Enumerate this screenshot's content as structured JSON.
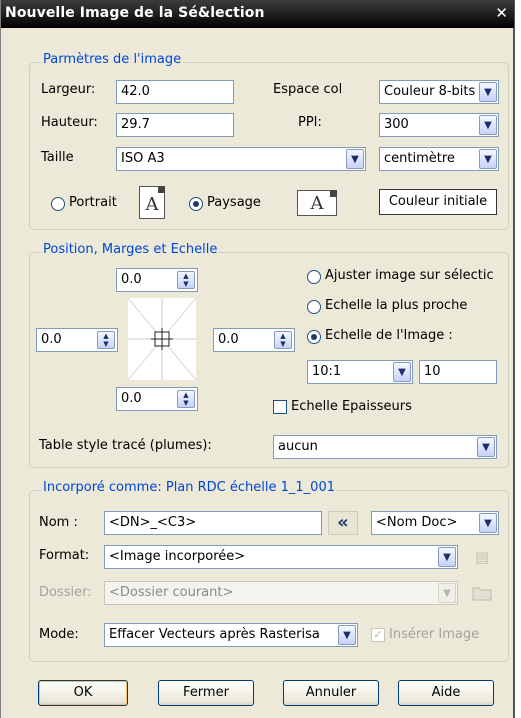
{
  "window": {
    "title": "Nouvelle Image de la Sé&lection",
    "close_glyph": "✕"
  },
  "image_params": {
    "group_title": "Parmètres de l'image",
    "width_label": "Largeur:",
    "width_value": "42.0",
    "height_label": "Hauteur:",
    "height_value": "29.7",
    "size_label": "Taille",
    "size_value": "ISO A3",
    "colorspace_label": "Espace col",
    "colorspace_value": "Couleur 8-bits",
    "ppi_label": "PPI:",
    "ppi_value": "300",
    "unit_value": "centimètre",
    "portrait_label": "Portrait",
    "portrait_selected": false,
    "landscape_label": "Paysage",
    "landscape_selected": true,
    "page_icon_glyph": "A",
    "initial_color_button": "Couleur initiale"
  },
  "position": {
    "group_title": "Position, Marges et Echelle",
    "margin_top": "0.0",
    "margin_left": "0.0",
    "margin_right": "0.0",
    "margin_bottom": "0.0",
    "fit_label": "Ajuster image sur sélectic",
    "fit_selected": false,
    "nearest_label": "Echelle la plus proche",
    "nearest_selected": false,
    "image_scale_label": "Echelle de l'Image :",
    "image_scale_selected": true,
    "scale_select": "10:1",
    "scale_value": "10",
    "thickness_scale_label": "Echelle Epaisseurs",
    "thickness_scale_checked": false,
    "pen_table_label": "Table style tracé (plumes):",
    "pen_table_value": "aucun"
  },
  "embed": {
    "group_title": "Incorporé comme: Plan RDC échelle 1_1_001",
    "name_label": "Nom :",
    "name_value": "<DN>_<C3>",
    "chevron_glyph": "«",
    "name_source_value": "<Nom Doc>",
    "format_label": "Format:",
    "format_value": "<Image incorporée>",
    "folder_label": "Dossier:",
    "folder_value": "<Dossier courant>",
    "mode_label": "Mode:",
    "mode_value": "Effacer Vecteurs après Rasterisa",
    "insert_image_label": "Insérer Image",
    "insert_image_checked": true
  },
  "buttons": {
    "ok": "OK",
    "close": "Fermer",
    "cancel": "Annuler",
    "help": "Aide"
  },
  "colors": {
    "group_title": "#0046d5",
    "dialog_bg": "#ece9d8",
    "titlebar": "#000000"
  }
}
